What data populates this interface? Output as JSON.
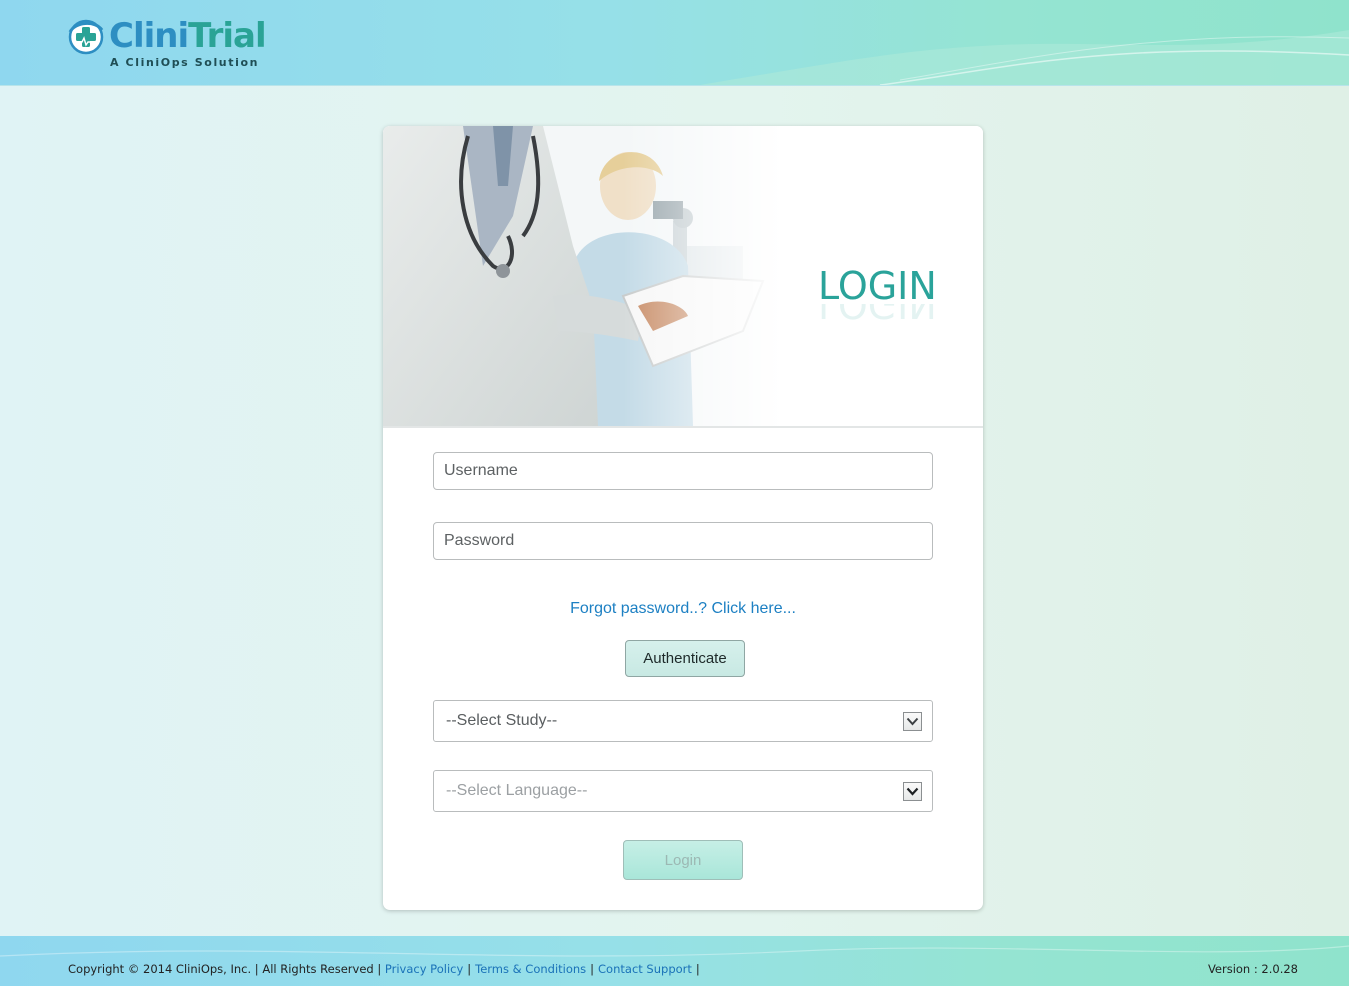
{
  "header": {
    "logo_name_part1": "Clini",
    "logo_name_part2": "Trial",
    "logo_tagline": "A CliniOps Solution"
  },
  "login_card": {
    "heading": "LOGIN",
    "username_placeholder": "Username",
    "password_placeholder": "Password",
    "forgot_link": "Forgot password..? Click here...",
    "authenticate_label": "Authenticate",
    "study_select": {
      "selected": "--Select Study--"
    },
    "language_select": {
      "selected": "--Select Language--"
    },
    "login_label": "Login"
  },
  "footer": {
    "copyright": "Copyright © 2014 CliniOps, Inc. | All Rights Reserved |",
    "links": {
      "privacy": "Privacy Policy",
      "terms": "Terms & Conditions",
      "support": "Contact Support"
    },
    "separator": "|",
    "version": "Version : 2.0.28"
  },
  "colors": {
    "brand_teal": "#2aa39a",
    "brand_blue": "#2d8ec2",
    "link_blue": "#1d80c3"
  },
  "icons": {
    "logo": "medical-cross-logo-icon",
    "select_arrow": "chevron-down-icon"
  }
}
